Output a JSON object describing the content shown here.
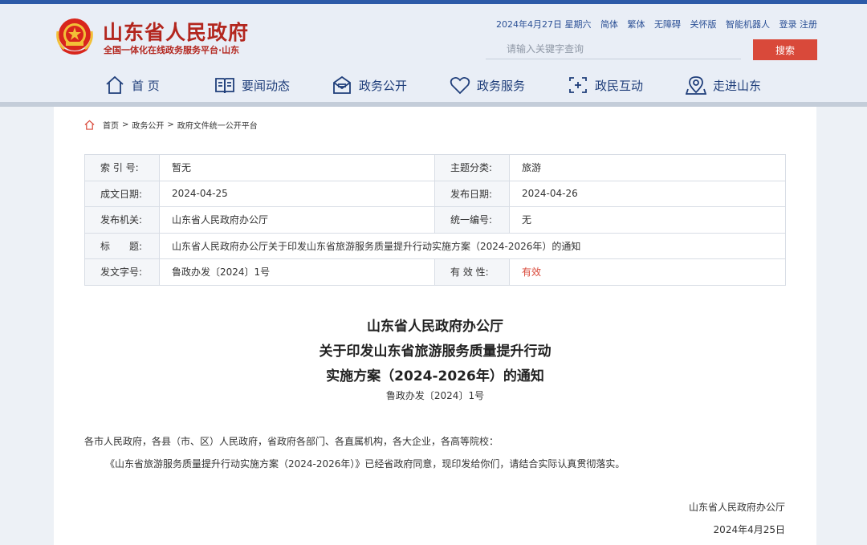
{
  "header": {
    "site_title": "山东省人民政府",
    "site_subtitle": "全国一体化在线政务服务平台·山东",
    "date": "2024年4月27日 星期六",
    "links": [
      "简体",
      "繁体",
      "无障碍",
      "关怀版",
      "智能机器人",
      "登录 注册"
    ],
    "search_placeholder": "请输入关键字查询",
    "search_button": "搜索"
  },
  "nav": [
    {
      "label": "首 页",
      "icon": "home-icon"
    },
    {
      "label": "要闻动态",
      "icon": "news-icon"
    },
    {
      "label": "政务公开",
      "icon": "open-gov-icon"
    },
    {
      "label": "政务服务",
      "icon": "heart-service-icon"
    },
    {
      "label": "政民互动",
      "icon": "interaction-icon"
    },
    {
      "label": "走进山东",
      "icon": "location-icon"
    }
  ],
  "breadcrumb": [
    "首页",
    "政务公开",
    "政府文件统一公开平台"
  ],
  "meta": {
    "index_label": "索 引 号:",
    "index_value": "暂无",
    "topic_label": "主题分类:",
    "topic_value": "旅游",
    "created_label": "成文日期:",
    "created_value": "2024-04-25",
    "published_label": "发布日期:",
    "published_value": "2024-04-26",
    "issuer_label": "发布机关:",
    "issuer_value": "山东省人民政府办公厅",
    "serial_label": "统一编号:",
    "serial_value": "无",
    "title_label": "标　　题:",
    "title_value": "山东省人民政府办公厅关于印发山东省旅游服务质量提升行动实施方案（2024-2026年）的通知",
    "docno_label": "发文字号:",
    "docno_value": "鲁政办发〔2024〕1号",
    "validity_label": "有 效 性:",
    "validity_value": "有效",
    "validity_color": "#d9493a"
  },
  "document": {
    "title_line1": "山东省人民政府办公厅",
    "title_line2": "关于印发山东省旅游服务质量提升行动",
    "title_line3": "实施方案（2024-2026年）的通知",
    "number": "鲁政办发〔2024〕1号",
    "recipients": "各市人民政府，各县（市、区）人民政府，省政府各部门、各直属机构，各大企业，各高等院校：",
    "paragraph1": "《山东省旅游服务质量提升行动实施方案（2024-2026年）》已经省政府同意，现印发给你们，请结合实际认真贯彻落实。",
    "signature": "山东省人民政府办公厅",
    "sign_date": "2024年4月25日"
  },
  "colors": {
    "brand_red": "#b3261e",
    "nav_blue": "#1f3e7a",
    "search_button": "#d9493a"
  }
}
